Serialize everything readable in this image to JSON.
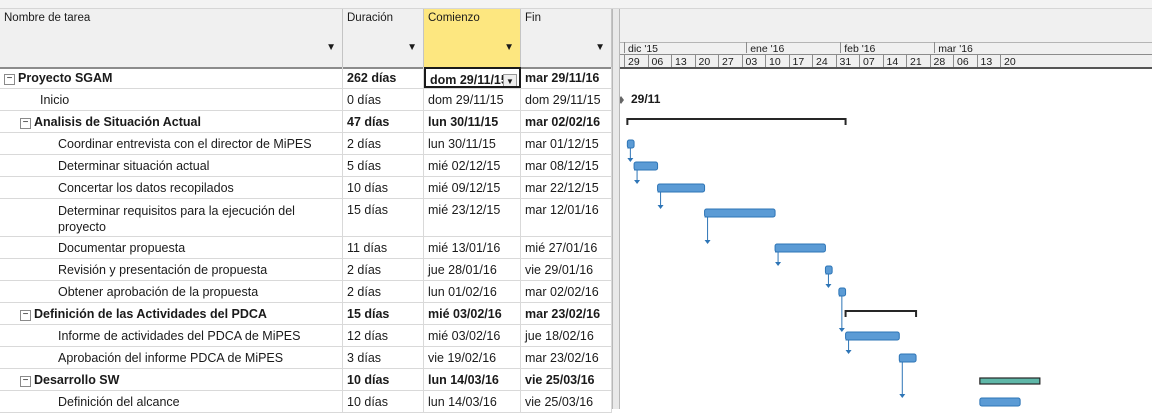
{
  "columns": {
    "name": "Nombre de tarea",
    "duration": "Duración",
    "start": "Comienzo",
    "end": "Fin"
  },
  "tasks": [
    {
      "name": "Proyecto SGAM",
      "duration": "262 días",
      "start": "dom 29/11/15",
      "end": "mar 29/11/16",
      "level": 0,
      "summary": true
    },
    {
      "name": "Inicio",
      "duration": "0 días",
      "start": "dom 29/11/15",
      "end": "dom 29/11/15",
      "level": 1
    },
    {
      "name": "Analisis de Situación Actual",
      "duration": "47 días",
      "start": "lun 30/11/15",
      "end": "mar 02/02/16",
      "level": 1,
      "summary": true
    },
    {
      "name": "Coordinar entrevista con el director de MiPES",
      "duration": "2 días",
      "start": "lun 30/11/15",
      "end": "mar 01/12/15",
      "level": 2
    },
    {
      "name": "Determinar situación actual",
      "duration": "5 días",
      "start": "mié 02/12/15",
      "end": "mar 08/12/15",
      "level": 2
    },
    {
      "name": "Concertar los datos recopilados",
      "duration": "10 días",
      "start": "mié 09/12/15",
      "end": "mar 22/12/15",
      "level": 2
    },
    {
      "name": "Determinar requisitos para la ejecución del proyecto",
      "duration": "15 días",
      "start": "mié 23/12/15",
      "end": "mar 12/01/16",
      "level": 2,
      "tall": true
    },
    {
      "name": "Documentar propuesta",
      "duration": "11 días",
      "start": "mié 13/01/16",
      "end": "mié 27/01/16",
      "level": 2
    },
    {
      "name": "Revisión y presentación de propuesta",
      "duration": "2 días",
      "start": "jue 28/01/16",
      "end": "vie 29/01/16",
      "level": 2
    },
    {
      "name": "Obtener aprobación de la propuesta",
      "duration": "2 días",
      "start": "lun 01/02/16",
      "end": "mar 02/02/16",
      "level": 2
    },
    {
      "name": "Definición de las Actividades del PDCA",
      "duration": "15 días",
      "start": "mié 03/02/16",
      "end": "mar 23/02/16",
      "level": 1,
      "summary": true
    },
    {
      "name": "Informe de actividades del PDCA de MiPES",
      "duration": "12 días",
      "start": "mié 03/02/16",
      "end": "jue 18/02/16",
      "level": 2
    },
    {
      "name": "Aprobación del informe PDCA de MiPES",
      "duration": "3 días",
      "start": "vie 19/02/16",
      "end": "mar 23/02/16",
      "level": 2
    },
    {
      "name": "Desarrollo SW",
      "duration": "10 días",
      "start": "lun 14/03/16",
      "end": "vie 25/03/16",
      "level": 1,
      "summary": true
    },
    {
      "name": "Definición del alcance",
      "duration": "10 días",
      "start": "lun 14/03/16",
      "end": "vie 25/03/16",
      "level": 2
    }
  ],
  "timescale": {
    "months": [
      "dic '15",
      "ene '16",
      "feb '16",
      "mar '16"
    ],
    "days": [
      "29",
      "06",
      "13",
      "20",
      "27",
      "03",
      "10",
      "17",
      "24",
      "31",
      "07",
      "14",
      "21",
      "28",
      "06",
      "13",
      "20"
    ]
  },
  "milestone_label": "29/11",
  "colors": {
    "bar_fill": "#5b9bd5",
    "bar_edge": "#2e75b6",
    "summary_bar": "#262626",
    "critical_bar": "#5fb7a8",
    "active_header": "#fde780"
  }
}
